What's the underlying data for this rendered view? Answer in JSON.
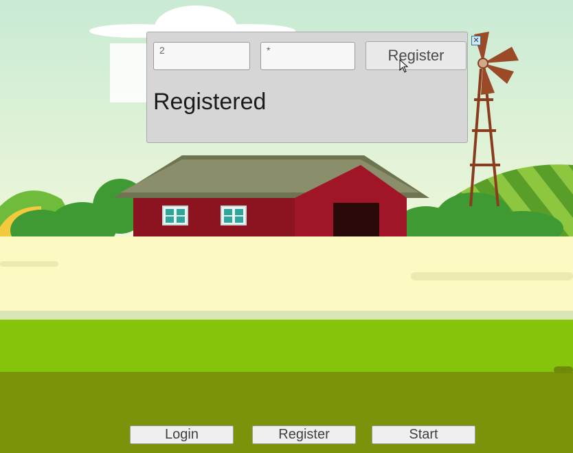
{
  "dialog": {
    "username_value": "2",
    "password_value": "*",
    "register_label": "Register",
    "status_text": "Registered",
    "close_glyph": "✕"
  },
  "menu": {
    "login_label": "Login",
    "register_label": "Register",
    "start_label": "Start"
  },
  "icons": {
    "close": "close-icon",
    "cursor": "mouse-pointer-icon"
  },
  "colors": {
    "sky": "#d8f0d8",
    "barn_red": "#9b1422",
    "field_cream": "#fdf9c3",
    "grass_light": "#86c40c",
    "grass_dark": "#7a930a"
  }
}
